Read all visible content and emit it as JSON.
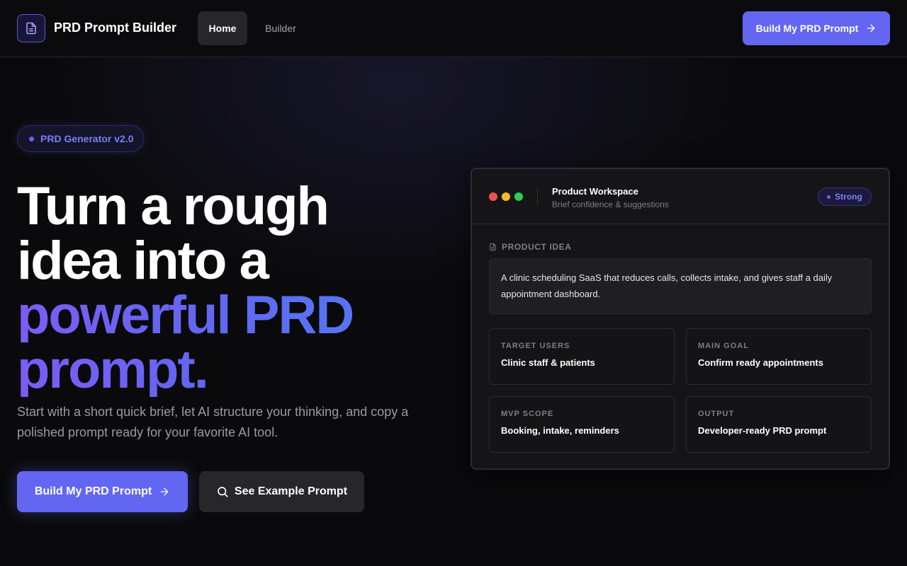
{
  "header": {
    "brand": "PRD Prompt Builder",
    "logo_icon": "document-icon",
    "nav": [
      {
        "label": "Home",
        "active": true
      },
      {
        "label": "Builder",
        "active": false
      }
    ],
    "cta_label": "Build My PRD Prompt",
    "cta_icon": "arrow-right-icon"
  },
  "hero": {
    "badge": "PRD Generator v2.0",
    "headline_lines": [
      "Turn a rough",
      "idea into a",
      "powerful PRD",
      "prompt."
    ],
    "subtext": "Start with a short quick brief, let AI structure your thinking, and copy a polished prompt ready for your favorite AI tool.",
    "primary_cta": "Build My PRD Prompt",
    "secondary_cta": "See Example Prompt",
    "secondary_icon": "search-icon"
  },
  "workspace": {
    "title": "Product Workspace",
    "subtitle": "Brief confidence & suggestions",
    "status": "Strong",
    "idea_label": "PRODUCT IDEA",
    "idea_text": "A clinic scheduling SaaS that reduces calls, collects intake, and gives staff a daily appointment dashboard.",
    "tiles": [
      {
        "label": "TARGET USERS",
        "value": "Clinic staff & patients"
      },
      {
        "label": "MAIN GOAL",
        "value": "Confirm ready appointments"
      },
      {
        "label": "MVP SCOPE",
        "value": "Booking, intake, reminders"
      },
      {
        "label": "OUTPUT",
        "value": "Developer-ready PRD prompt"
      }
    ]
  },
  "colors": {
    "accent": "#6366f1",
    "background": "#0a0a0c",
    "traffic_red": "#ef5350",
    "traffic_yellow": "#f5b82e",
    "traffic_green": "#2ecc52"
  }
}
